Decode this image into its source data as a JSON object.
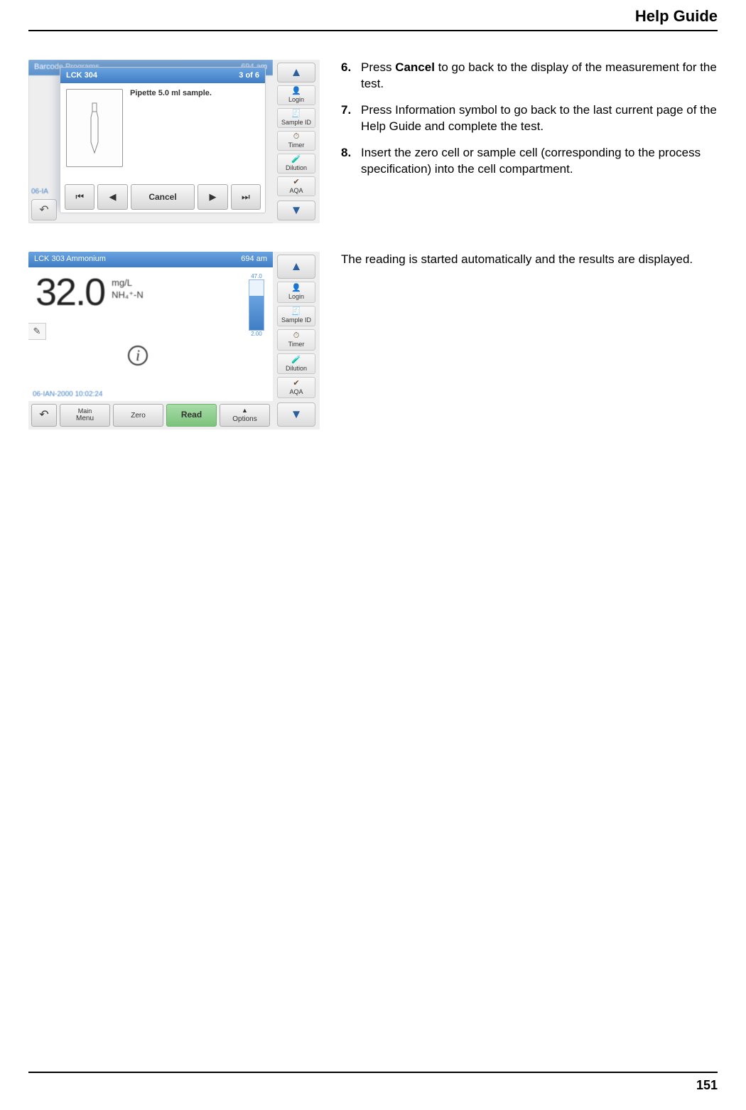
{
  "header": {
    "title": "Help Guide"
  },
  "footer": {
    "page_number": "151"
  },
  "steps": [
    {
      "num": "6.",
      "pre": "Press ",
      "bold": "Cancel",
      "post": " to go back to the display of the measurement for the test."
    },
    {
      "num": "7.",
      "pre": "Press Information symbol to go back to the last current page of the Help Guide and complete the test.",
      "bold": "",
      "post": ""
    },
    {
      "num": "8.",
      "pre": "Insert the zero cell or sample cell (corresponding to the process specification) into the cell compartment.",
      "bold": "",
      "post": ""
    }
  ],
  "result_paragraph": "The reading is started automatically and the results are displayed.",
  "side_nav": {
    "items": [
      {
        "label": "Login",
        "icon": "👤"
      },
      {
        "label": "Sample ID",
        "icon": "🧾"
      },
      {
        "label": "Timer",
        "icon": "⏱"
      },
      {
        "label": "Dilution",
        "icon": "🧪"
      },
      {
        "label": "AQA",
        "icon": "✔"
      }
    ]
  },
  "frame1": {
    "bg_title_left": "Barcode Programs",
    "bg_title_right": "694 am",
    "bg_status": "06-IA",
    "modal": {
      "title_left": "LCK 304",
      "title_right": "3 of 6",
      "instruction": "Pipette 5.0 ml sample.",
      "cancel_label": "Cancel"
    }
  },
  "frame2": {
    "title_left": "LCK 303 Ammonium",
    "title_right": "694 am",
    "value": "32.0",
    "unit1": "mg/L",
    "unit2": "NH₄⁺-N",
    "bar_top": "47.0",
    "bar_bot": "2.00",
    "timestamp": "06-IAN-2000  10:02:24",
    "buttons": {
      "main1": "Main",
      "main2": "Menu",
      "zero": "Zero",
      "read": "Read",
      "options": "Options"
    }
  }
}
